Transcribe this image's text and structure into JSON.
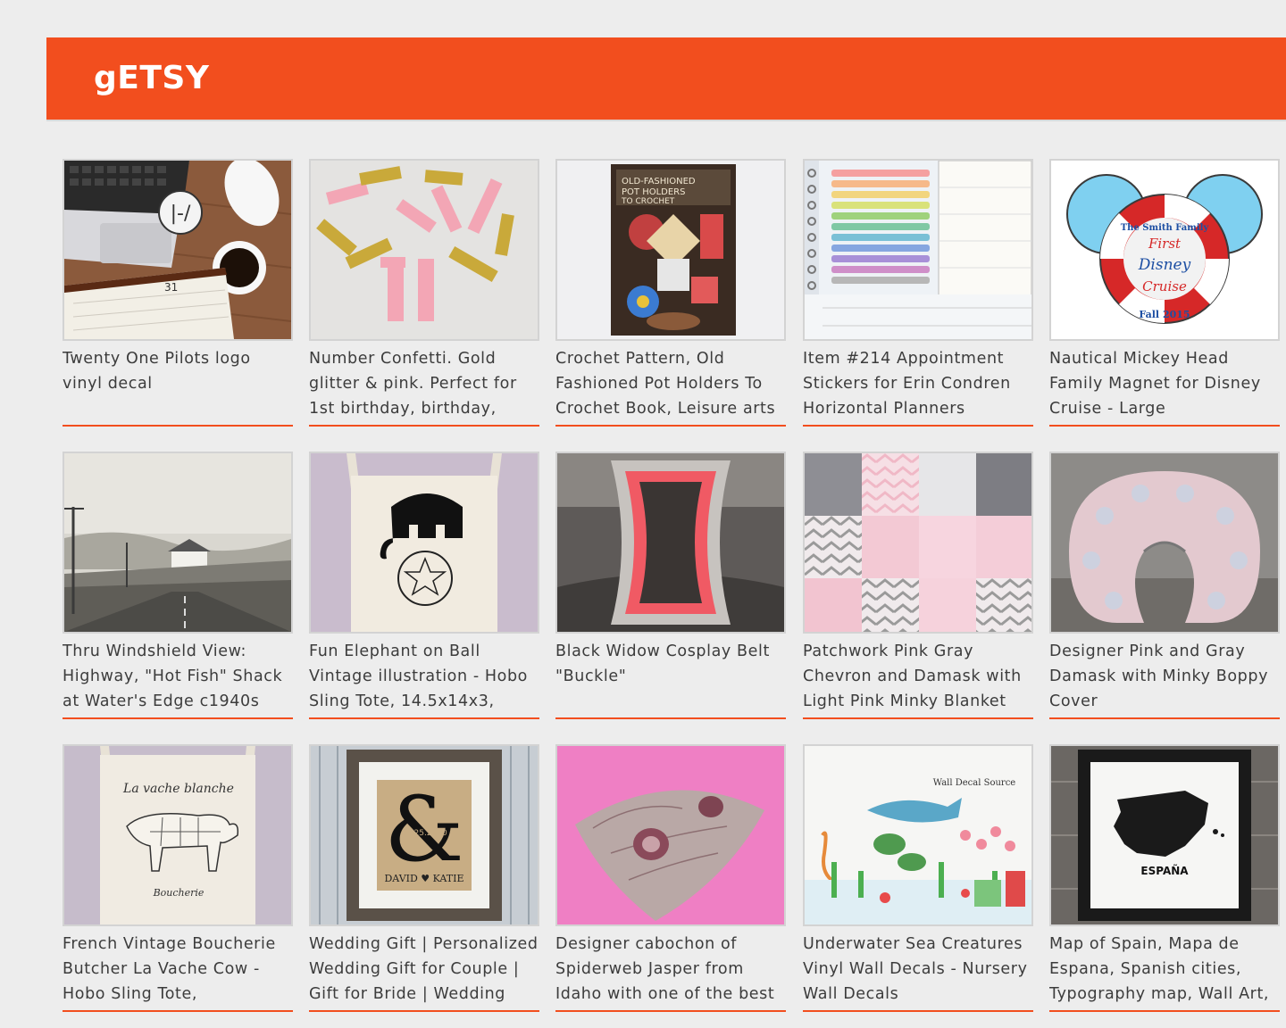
{
  "app": {
    "logo": "gETSY",
    "accent": "#f24e1e"
  },
  "listings": [
    {
      "title": "Twenty One Pilots logo vinyl decal",
      "image": "laptop-coffee-desk-photo"
    },
    {
      "title": "Number Confetti. Gold glitter & pink. Perfect for 1st birthday, birthday,",
      "image": "number-one-confetti-photo"
    },
    {
      "title": "Crochet Pattern, Old Fashioned Pot Holders To Crochet Book, Leisure arts",
      "image": "crochet-book-cover-photo"
    },
    {
      "title": "Item #214 Appointment Stickers for Erin Condren Horizontal Planners",
      "image": "planner-stickers-photo"
    },
    {
      "title": "Nautical Mickey Head Family Magnet for Disney Cruise - Large",
      "image": "mickey-life-ring-magnet",
      "image_text": [
        "The Smith Family",
        "First",
        "Disney",
        "Cruise",
        "Fall 2015"
      ]
    },
    {
      "title": "Thru Windshield View: Highway, \"Hot Fish\" Shack at Water's Edge c1940s",
      "image": "vintage-highway-photo"
    },
    {
      "title": "Fun Elephant on Ball Vintage illustration - Hobo Sling Tote, 14.5x14x3,",
      "image": "elephant-tote-photo"
    },
    {
      "title": "Black Widow Cosplay Belt \"Buckle\"",
      "image": "cosplay-belt-buckle-photo"
    },
    {
      "title": "Patchwork Pink Gray Chevron and Damask with Light Pink Minky Blanket",
      "image": "patchwork-blanket-photo"
    },
    {
      "title": "Designer Pink and Gray Damask with Minky Boppy Cover",
      "image": "boppy-pillow-photo"
    },
    {
      "title": "French Vintage Boucherie Butcher La Vache Cow - Hobo Sling Tote,",
      "image": "cow-butcher-tote-photo",
      "image_text": [
        "La vache blanche",
        "Boucherie"
      ]
    },
    {
      "title": "Wedding Gift | Personalized Wedding Gift for Couple | Gift for Bride | Wedding",
      "image": "ampersand-burlap-frame-photo",
      "image_text": [
        "&",
        "06.25.2010",
        "DAVID ♥ KATIE"
      ]
    },
    {
      "title": "Designer cabochon of Spiderweb Jasper from Idaho with one of the best",
      "image": "jasper-cabochon-photo"
    },
    {
      "title": "Underwater Sea Creatures Vinyl Wall Decals - Nursery Wall Decals",
      "image": "sea-creatures-decal-photo",
      "image_text": [
        "Wall Decal Source"
      ]
    },
    {
      "title": "Map of Spain, Mapa de Espana, Spanish cities, Typography map, Wall Art,",
      "image": "spain-map-print-photo",
      "image_text": [
        "ESPAÑA"
      ]
    }
  ]
}
